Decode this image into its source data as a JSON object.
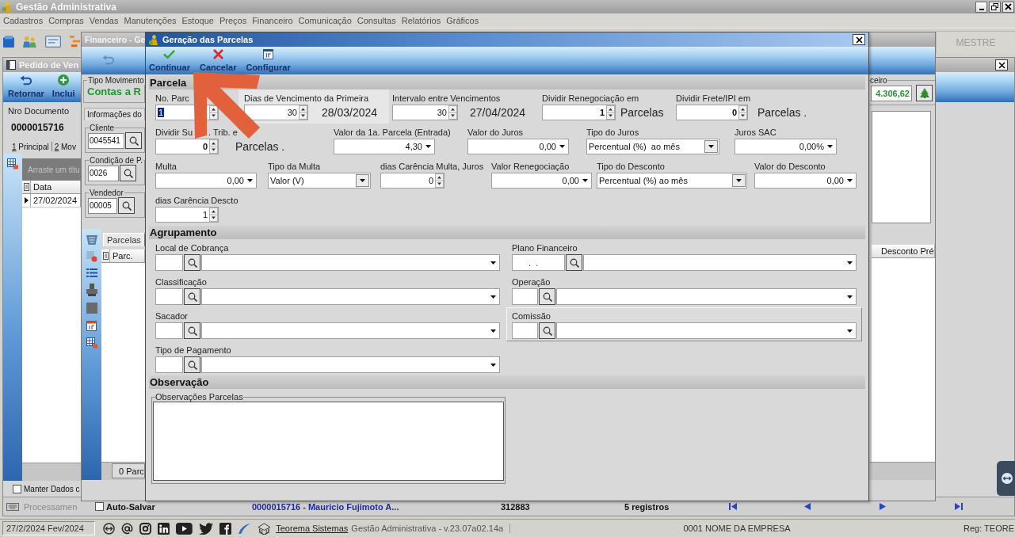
{
  "app": {
    "title": "Gestão Administrativa",
    "menu": [
      "Cadastros",
      "Compras",
      "Vendas",
      "Manutenções",
      "Estoque",
      "Preços",
      "Financeiro",
      "Comunicação",
      "Consultas",
      "Relatórios",
      "Gráficos"
    ],
    "toolbar_tab": "MESTRE"
  },
  "order_window": {
    "title": "Pedido de Ven",
    "toolbar": [
      {
        "label": "Retornar",
        "kind": "back"
      },
      {
        "label": "Inclui",
        "kind": "add"
      }
    ],
    "document_label": "Nro Documento",
    "document_number": "0000015716",
    "tabs": [
      "1 Principal",
      "2 Mov"
    ],
    "group_hint": "Arraste um títu",
    "grid": {
      "columns": [
        "Data"
      ],
      "rows": [
        {
          "cells": [
            "27/02/2024"
          ],
          "selected": true
        }
      ]
    },
    "keep_data": {
      "label": "Manter Dados c",
      "checked": false
    },
    "record_bar": {
      "process_button": "Processamen",
      "auto_save": {
        "label": "Auto-Salvar",
        "checked": false
      },
      "document": "0000015716 - Mauricio Fujimoto A...",
      "code": "312883",
      "records": "5 registros"
    }
  },
  "finance_window": {
    "title": "Financeiro - Ge",
    "movement": {
      "legend": "Tipo Movimento",
      "value": "Contas a R"
    },
    "info_tab": "Informações do",
    "lookups": [
      {
        "legend": "Cliente",
        "value": "0045541"
      },
      {
        "legend": "Condição de P.",
        "value": "0026"
      },
      {
        "legend": "Vendedor",
        "value": "00005"
      }
    ],
    "tabs": [
      {
        "label": "Parcelas",
        "selected": true
      }
    ],
    "grid": {
      "columns": [
        "Parc."
      ]
    },
    "footer": "0 Parc",
    "total": {
      "legend": "ceiro",
      "value": "4.306,62"
    },
    "right_grid": {
      "columns": [
        "Desconto Pré"
      ]
    }
  },
  "dialog": {
    "title": "Geração das Parcelas",
    "toolbar": [
      {
        "label": "Continuar",
        "kind": "confirm"
      },
      {
        "label": "Cancelar",
        "kind": "cancel"
      },
      {
        "label": "Configurar",
        "kind": "configure"
      }
    ],
    "installments": {
      "title": "Parcela",
      "rows": [
        [
          {
            "label": "No. Parc",
            "kind": "spin",
            "value": "1",
            "focused": true,
            "highlighted": false
          },
          {
            "label": "Dias de Vencimento da Primeira",
            "kind": "spin",
            "value": "30",
            "suffix": "28/03/2024",
            "focused": false,
            "highlighted": true
          },
          {
            "label": "Intervalo entre Vencimentos",
            "kind": "spin",
            "value": "30",
            "suffix": "27/04/2024",
            "focused": false,
            "highlighted": false
          },
          {
            "label": "Dividir Renegociação em",
            "kind": "count",
            "value": "1",
            "suffix": "Parcelas",
            "focused": false,
            "highlighted": false
          },
          {
            "label": "Dividir Frete/IPI em",
            "kind": "count",
            "value": "0",
            "suffix": "Parcelas .",
            "focused": false,
            "highlighted": false
          }
        ],
        [
          {
            "label": "Dividir Su",
            "label_tail": ". Trib. e",
            "kind": "count",
            "value": "0",
            "suffix": "Parcelas .",
            "focused": false,
            "highlighted": false
          },
          {
            "label": "Valor da 1a. Parcela (Entrada)",
            "kind": "amount",
            "value": "4,30",
            "focused": false,
            "highlighted": false
          },
          {
            "label": "Valor do Juros",
            "kind": "amount",
            "value": "0,00",
            "focused": false,
            "highlighted": false
          },
          {
            "label": "Tipo do Juros",
            "kind": "select",
            "value": "Percentual (%)  ao mês",
            "focused": false,
            "highlighted": false
          },
          {
            "label": "Juros SAC",
            "kind": "amount",
            "value": "0,00%",
            "focused": false,
            "highlighted": false
          }
        ],
        [
          {
            "label": "Multa",
            "kind": "amount",
            "value": "0,00",
            "focused": false,
            "highlighted": false
          },
          {
            "label": "Tipo da Multa",
            "kind": "select",
            "value": "Valor (V)",
            "focused": false,
            "highlighted": false
          },
          {
            "label": "dias Carência Multa, Juros",
            "kind": "spin",
            "value": "0",
            "focused": false,
            "highlighted": false
          },
          {
            "label": "Valor Renegociação",
            "kind": "amount",
            "value": "0,00",
            "focused": false,
            "highlighted": false
          },
          {
            "label": "Tipo do Desconto",
            "kind": "select",
            "value": "Percentual (%) ao mês",
            "focused": false,
            "highlighted": false
          },
          {
            "label": "Valor do Desconto",
            "kind": "amount",
            "value": "0,00",
            "focused": false,
            "highlighted": false
          }
        ],
        [
          {
            "label": "dias Carência Descto",
            "kind": "spin",
            "value": "1",
            "focused": false,
            "highlighted": false
          }
        ]
      ]
    },
    "grouping": {
      "title": "Agrupamento",
      "lookups": [
        {
          "label": "Local de Cobrança",
          "highlighted": false
        },
        {
          "label": "Plano Financeiro",
          "value": ".  .",
          "highlighted": false
        },
        {
          "label": "Classificação",
          "highlighted": false
        },
        {
          "label": "Operação",
          "highlighted": false
        },
        {
          "label": "Sacador",
          "highlighted": false
        },
        {
          "label": "Comissão",
          "highlighted": true
        },
        {
          "label": "Tipo de Pagamento",
          "highlighted": false
        }
      ]
    },
    "notes": {
      "title": "Observação",
      "legend": "Observações Parcelas"
    }
  },
  "tutorial_arrow": true,
  "status_bar": {
    "date": "27/2/2024 Fev/2024",
    "link": "Teorema Sistemas",
    "version": "Gestão Administrativa - v.23.07a02.14a",
    "company": "0001 NOME DA EMPRESA",
    "registration": "Reg: TEORE"
  }
}
